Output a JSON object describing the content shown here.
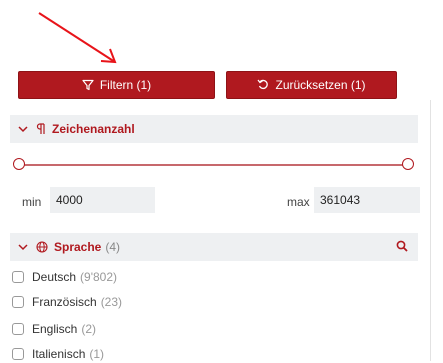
{
  "toolbar": {
    "filter_label": "Filtern (1)",
    "reset_label": "Zurücksetzen (1)"
  },
  "char_count": {
    "title": "Zeichenanzahl",
    "min_label": "min",
    "max_label": "max",
    "min_value": "4000",
    "max_value": "361043"
  },
  "language": {
    "title": "Sprache",
    "count": "(4)",
    "items": [
      {
        "label": "Deutsch",
        "count": "(9'802)"
      },
      {
        "label": "Französisch",
        "count": "(23)"
      },
      {
        "label": "Englisch",
        "count": "(2)"
      },
      {
        "label": "Italienisch",
        "count": "(1)"
      }
    ]
  },
  "colors": {
    "accent": "#b0191f",
    "panel_bg": "#eef0f2",
    "annotation_arrow": "#e8141a"
  }
}
